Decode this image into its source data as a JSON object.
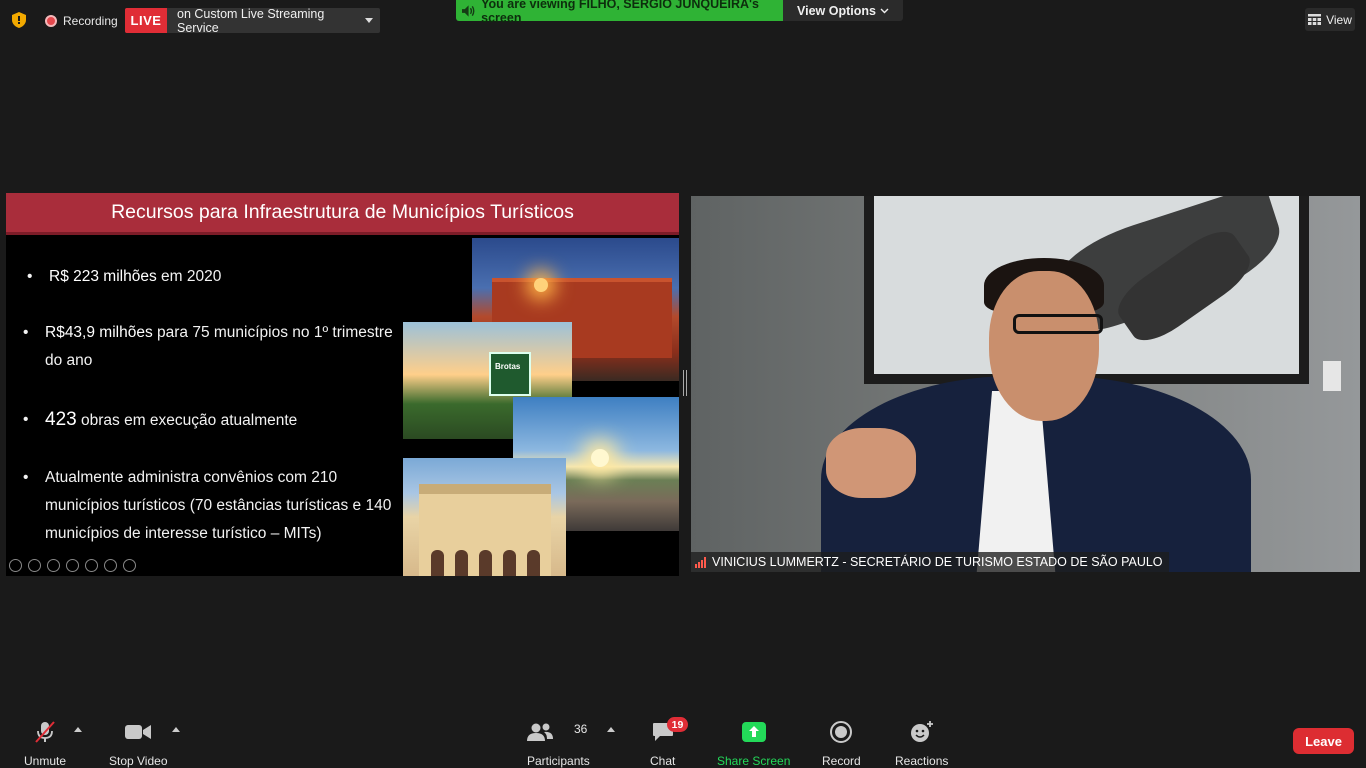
{
  "topbar": {
    "recording_label": "Recording",
    "live_label": "LIVE",
    "live_service": "on Custom Live Streaming Service",
    "viewing_text": "You are viewing FILHO, SERGIO JUNQUEIRA's screen",
    "view_options_label": "View Options",
    "view_label": "View"
  },
  "slide": {
    "title": "Recursos para Infraestrutura de Municípios Turísticos",
    "bullets": [
      {
        "bold": "R$ 223 milhões",
        "rest": "  em 2020"
      },
      {
        "bold": "R$43,9 milhões",
        "rest": " para 75 municípios no 1º trimestre"
      },
      {
        "line2": "do ano"
      },
      {
        "bold": "423",
        "rest": " obras em execução atualmente"
      },
      {
        "line1": "Atualmente administra convênios com 210",
        "line2": "municípios turísticos (70 estâncias turísticas e 140",
        "line3": "municípios de interesse turístico – MITs)"
      }
    ],
    "sign_text": "Brotas",
    "bullet_symbol": "•",
    "accent_color": "#a92d3b"
  },
  "video": {
    "participant_name": "VINICIUS LUMMERTZ - SECRETÁRIO DE TURISMO ESTADO DE SÃO PAULO"
  },
  "toolbar": {
    "unmute_label": "Unmute",
    "stop_video_label": "Stop Video",
    "participants_label": "Participants",
    "participants_count": "36",
    "chat_label": "Chat",
    "chat_badge": "19",
    "share_screen_label": "Share Screen",
    "record_label": "Record",
    "reactions_label": "Reactions",
    "leave_label": "Leave"
  },
  "colors": {
    "background": "#1a1a1a",
    "live_red": "#e02d36",
    "viewing_green": "#2fb335",
    "share_green": "#23d959",
    "leave_red": "#dd2d32"
  }
}
